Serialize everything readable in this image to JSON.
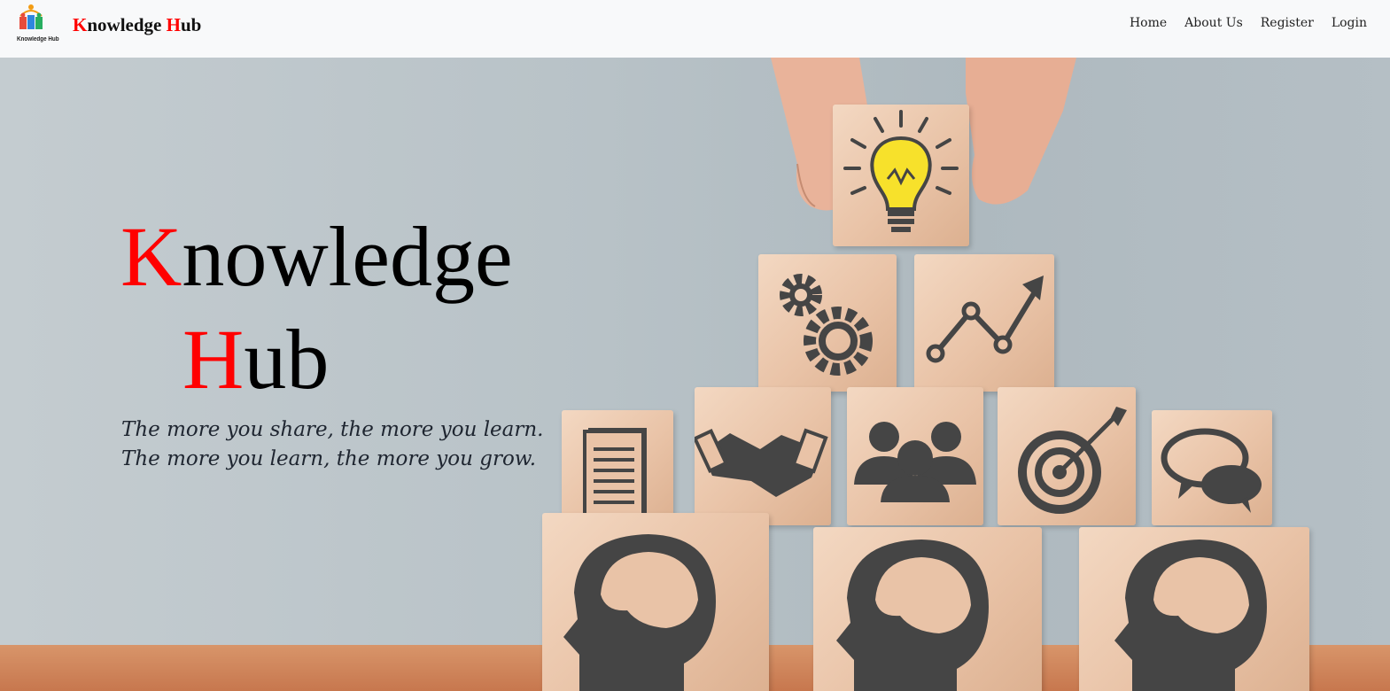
{
  "navbar": {
    "logo_text": "Knowledge Hub",
    "brand_first": "K",
    "brand_mid": "nowledge ",
    "brand_second": "H",
    "brand_end": "ub",
    "links": [
      "Home",
      "About Us",
      "Register",
      "Login"
    ]
  },
  "hero": {
    "title_line1_initial": "K",
    "title_line1_rest": "nowledge",
    "title_line2_initial": "H",
    "title_line2_rest": "ub",
    "tagline_1": "The more you share, the more you learn.",
    "tagline_2": "The more you learn, the more you grow."
  },
  "colors": {
    "accent": "#ff0000",
    "navbar_bg": "#f8f9fa",
    "icon": "#454545"
  },
  "icons": [
    "lightbulb-icon",
    "gears-icon",
    "growth-chart-icon",
    "documents-icon",
    "handshake-icon",
    "team-icon",
    "target-icon",
    "speech-bubbles-icon",
    "head-brain-icon"
  ]
}
